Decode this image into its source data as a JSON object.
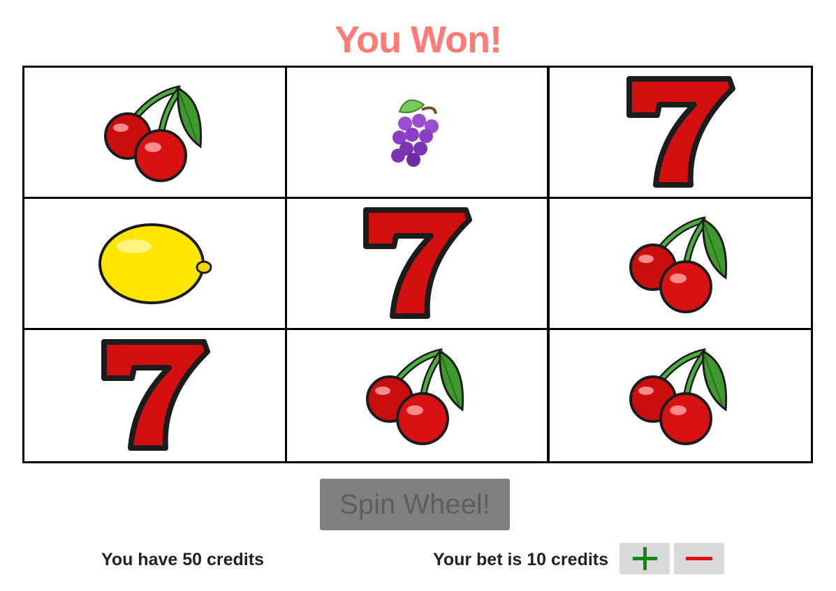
{
  "header": {
    "title": "You Won!"
  },
  "reels": {
    "cells": [
      {
        "symbol": "cherry"
      },
      {
        "symbol": "grapes"
      },
      {
        "symbol": "seven"
      },
      {
        "symbol": "lemon"
      },
      {
        "symbol": "seven"
      },
      {
        "symbol": "cherry"
      },
      {
        "symbol": "seven"
      },
      {
        "symbol": "cherry"
      },
      {
        "symbol": "cherry"
      }
    ]
  },
  "controls": {
    "spin_label": "Spin Wheel!",
    "credits_text": "You have 50 credits",
    "bet_text": "Your bet is 10 credits",
    "increase_icon": "plus-icon",
    "decrease_icon": "minus-icon"
  },
  "colors": {
    "title": "#ff7b78",
    "spin_button": "#808080",
    "plus": "#118811",
    "minus": "#e01010"
  }
}
